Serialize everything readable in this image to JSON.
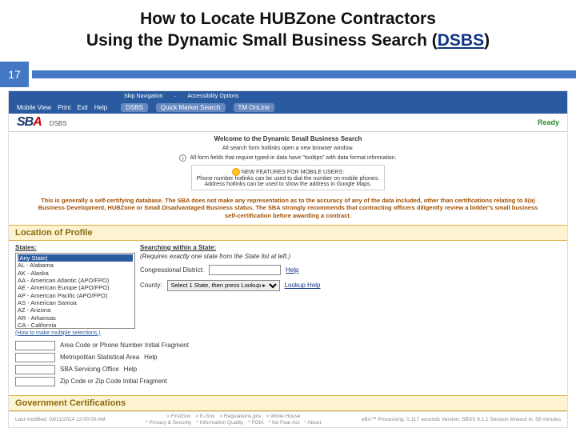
{
  "title_line1": "How to Locate HUBZone Contractors",
  "title_line2_before": "Using the Dynamic Small Business Search (",
  "title_line2_link": "DSBS",
  "title_line2_after": ")",
  "page_number": "17",
  "topnav": {
    "skip": "Skip Navigation",
    "access": "Accessibility Options",
    "items": [
      "Mobile View",
      "Print",
      "Exit",
      "Help"
    ]
  },
  "pills": [
    "DSBS",
    "Quick Market Search",
    "TM OnLine"
  ],
  "logo_text": "SBA",
  "logo_sub": "DSBS",
  "ready": "Ready",
  "intro": {
    "welcome": "Welcome to the Dynamic Small Business Search",
    "line1": "All search form hotlinks open a new browser window.",
    "line2_pre": "All form fields that require typed-in data have \"tooltips\" with data format information.",
    "newbox_title": "NEW FEATURES FOR MOBILE USERS:",
    "newbox_l1": "Phone number hotlinks can be used to dial the number on mobile phones.",
    "newbox_l2": "Address hotlinks can be used to show the address in Google Maps."
  },
  "disclaimer": "This is generally a self-certifying database. The SBA does not make any representation as to the accuracy of any of the data included, other than certifications relating to 8(a) Business Development, HUBZone or Small Disadvantaged Business status. The SBA strongly recommends that contracting officers diligently review a bidder's small business self-certification before awarding a contract.",
  "sections": {
    "location": "Location of Profile",
    "gov": "Government Certifications"
  },
  "states_label": "States:",
  "states": [
    "(Any State)",
    "AL - Alabama",
    "AK - Alaska",
    "AA - American Atlantic (APO/FPO)",
    "AE - American Europe (APO/FPO)",
    "AP - American Pacific (APO/FPO)",
    "AS - American Samoa",
    "AZ - Arizona",
    "AR - Arkansas",
    "CA - California"
  ],
  "multi_hint": "(How to make multiple selections.)",
  "within_label": "Searching within a State:",
  "within_note": "(Requires exactly one state from the State list at left.)",
  "cong_label": "Congressional District:",
  "help": "Help",
  "county_label": "County:",
  "county_value": "Select 1 State, then press Lookup ▸",
  "lookup_help": "Lookup Help",
  "fields": {
    "area": "Area Code or Phone Number Initial Fragment",
    "msa": "Metropolitan Statistical Area",
    "sba_office": "SBA Servicing Office",
    "zip": "Zip Code or Zip Code Initial Fragment"
  },
  "footer": {
    "modified": "Last modified: 03/11/2014 12:00:00 AM",
    "links_top": [
      "> FirstGov",
      "> E-Gov",
      "> Regulations.gov",
      "> White House"
    ],
    "links_bot": [
      "* Privacy & Security",
      "* Information Quality",
      "* FOIA",
      "* No Fear Act",
      "* About"
    ],
    "right": "eBA™ Processing:  0.117 seconds Version: SBSS 8.1.1   Session timeout in: 59 minutes"
  }
}
